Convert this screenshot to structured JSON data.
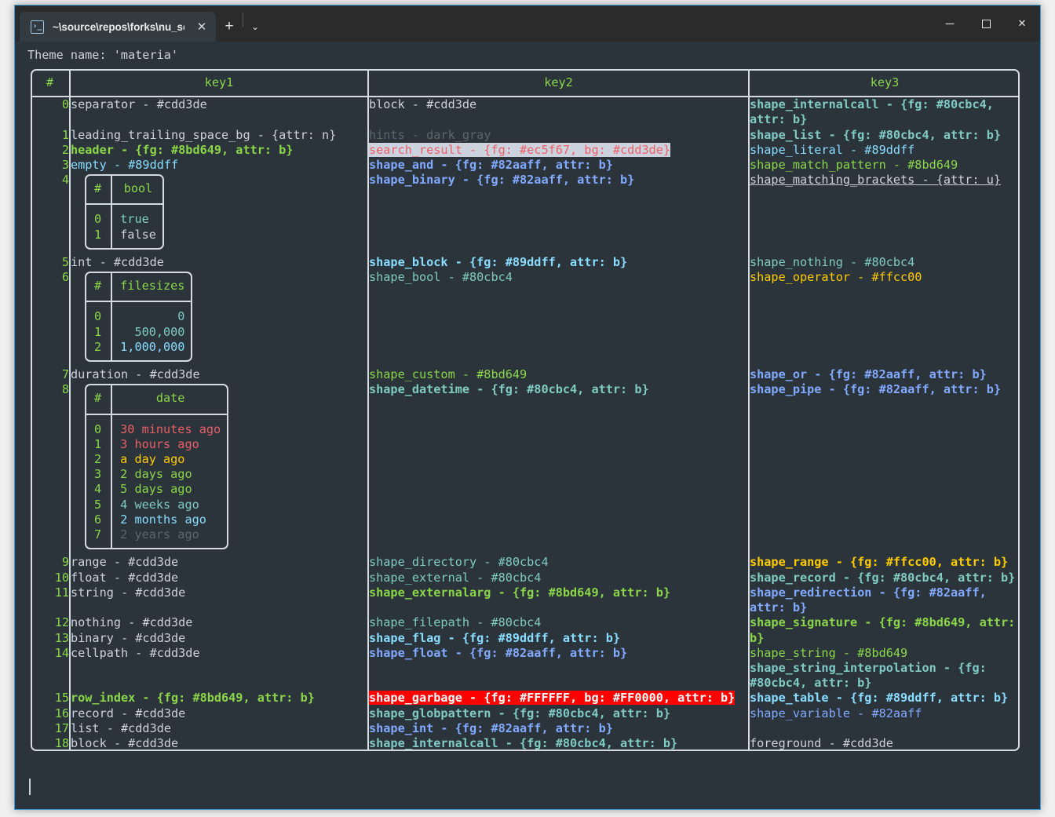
{
  "window": {
    "tab": {
      "icon": "powershell-prompt-icon",
      "title": "~\\source\\repos\\forks\\nu_scrip",
      "close_label": "✕"
    },
    "new_tab_label": "+",
    "dropdown_label": "⌄",
    "minimize_label": "─",
    "maximize_label": "",
    "close_label": "✕",
    "accent_color": "#3a9fe0",
    "titlebar_color": "#2b2b2b",
    "terminal_bg": "#2b333b"
  },
  "terminal": {
    "first_line": "Theme name: 'materia'",
    "prompt_cursor": "|"
  },
  "table": {
    "headers": [
      "#",
      "key1",
      "key2",
      "key3"
    ],
    "row_groups": [
      {
        "indices": [
          "0"
        ],
        "key1": [
          {
            "t": "separator - #cdd3de",
            "c": "fg"
          }
        ],
        "key2": [
          {
            "t": "block - #cdd3de",
            "c": "fg"
          }
        ],
        "key3": [
          {
            "t": "shape_internalcall - {fg: #80cbc4, attr: b}",
            "c": "cyan bold"
          }
        ]
      },
      {
        "indices": [
          "1",
          "2",
          "3",
          "4"
        ],
        "key1": [
          {
            "t": "leading_trailing_space_bg - {attr: n}",
            "c": "fg"
          },
          {
            "t": "header - {fg: #8bd649, attr: b}",
            "c": "green bold"
          },
          {
            "t": "empty - #89ddff",
            "c": "ltblue"
          }
        ],
        "key2": [
          {
            "t": "hints - dark_gray",
            "c": "gray"
          },
          {
            "t": "search_result - {fg: #ec5f67, bg: #cdd3de}",
            "c": "hl-search"
          },
          {
            "t": "shape_and - {fg: #82aaff, attr: b}",
            "c": "blue bold"
          },
          {
            "t": "shape_binary - {fg: #82aaff, attr: b}",
            "c": "blue bold"
          }
        ],
        "key3": [
          {
            "t": "shape_list - {fg: #80cbc4, attr: b}",
            "c": "cyan bold"
          },
          {
            "t": "shape_literal - #89ddff",
            "c": "ltblue"
          },
          {
            "t": "shape_match_pattern - #8bd649",
            "c": "green"
          },
          {
            "t": "shape_matching_brackets - {attr: u}",
            "c": "fg uline"
          }
        ]
      },
      {
        "indices": [
          "5",
          "6"
        ],
        "key1": [
          {
            "t": "int - #cdd3de",
            "c": "fg"
          }
        ],
        "key2": [
          {
            "t": "shape_block - {fg: #89ddff, attr: b}",
            "c": "ltblue bold"
          },
          {
            "t": "shape_bool - #80cbc4",
            "c": "cyan"
          }
        ],
        "key3": [
          {
            "t": "shape_nothing - #80cbc4",
            "c": "cyan"
          },
          {
            "t": "shape_operator - #ffcc00",
            "c": "yellow"
          }
        ]
      },
      {
        "indices": [
          "7",
          "8"
        ],
        "key1": [
          {
            "t": "duration - #cdd3de",
            "c": "fg"
          }
        ],
        "key2": [
          {
            "t": "shape_custom - #8bd649",
            "c": "green"
          },
          {
            "t": "shape_datetime - {fg: #80cbc4, attr: b}",
            "c": "cyan bold"
          }
        ],
        "key3": [
          {
            "t": "shape_or - {fg: #82aaff, attr: b}",
            "c": "blue bold"
          },
          {
            "t": "shape_pipe - {fg: #82aaff, attr: b}",
            "c": "blue bold"
          }
        ]
      },
      {
        "indices": [
          "9",
          "10",
          "11"
        ],
        "key1": [
          {
            "t": "range - #cdd3de",
            "c": "fg"
          },
          {
            "t": "float - #cdd3de",
            "c": "fg"
          },
          {
            "t": "string - #cdd3de",
            "c": "fg"
          }
        ],
        "key2": [
          {
            "t": "shape_directory - #80cbc4",
            "c": "cyan"
          },
          {
            "t": "shape_external - #80cbc4",
            "c": "cyan"
          },
          {
            "t": "shape_externalarg - {fg: #8bd649, attr: b}",
            "c": "green bold"
          }
        ],
        "key3": [
          {
            "t": "shape_range - {fg: #ffcc00, attr: b}",
            "c": "yellow bold"
          },
          {
            "t": "shape_record - {fg: #80cbc4, attr: b}",
            "c": "cyan bold"
          },
          {
            "t": "shape_redirection - {fg: #82aaff, attr: b}",
            "c": "blue bold"
          }
        ]
      },
      {
        "indices": [
          "12",
          "13",
          "14"
        ],
        "key1": [
          {
            "t": "nothing - #cdd3de",
            "c": "fg"
          },
          {
            "t": "binary - #cdd3de",
            "c": "fg"
          },
          {
            "t": "cellpath - #cdd3de",
            "c": "fg"
          }
        ],
        "key2": [
          {
            "t": "shape_filepath - #80cbc4",
            "c": "cyan"
          },
          {
            "t": "shape_flag - {fg: #89ddff, attr: b}",
            "c": "ltblue bold"
          },
          {
            "t": "shape_float - {fg: #82aaff, attr: b}",
            "c": "blue bold"
          }
        ],
        "key3": [
          {
            "t": "shape_signature - {fg: #8bd649, attr: b}",
            "c": "green bold"
          },
          {
            "t": "shape_string - #8bd649",
            "c": "green"
          },
          {
            "t": "shape_string_interpolation - {fg: #80cbc4, attr: b}",
            "c": "cyan bold"
          }
        ]
      },
      {
        "indices": [
          "15",
          "16",
          "17",
          "18"
        ],
        "key1": [
          {
            "t": "row_index - {fg: #8bd649, attr: b}",
            "c": "green bold"
          },
          {
            "t": "record - #cdd3de",
            "c": "fg"
          },
          {
            "t": "list - #cdd3de",
            "c": "fg"
          },
          {
            "t": "block - #cdd3de",
            "c": "fg"
          }
        ],
        "key2": [
          {
            "t": "shape_garbage - {fg: #FFFFFF, bg: #FF0000, attr: b}",
            "c": "hl-garbage"
          },
          {
            "t": "shape_globpattern - {fg: #80cbc4, attr: b}",
            "c": "cyan bold"
          },
          {
            "t": "shape_int - {fg: #82aaff, attr: b}",
            "c": "blue bold"
          },
          {
            "t": "shape_internalcall - {fg: #80cbc4, attr: b}",
            "c": "cyan bold"
          }
        ],
        "key3": [
          {
            "t": "shape_table - {fg: #89ddff, attr: b}",
            "c": "ltblue bold"
          },
          {
            "t": "shape_variable - #82aaff",
            "c": "blue"
          },
          {
            "t": "",
            "c": "fg"
          },
          {
            "t": "foreground - #cdd3de",
            "c": "fg"
          }
        ]
      }
    ]
  },
  "nested_tables": {
    "bool": {
      "headers": [
        "#",
        "bool"
      ],
      "rows": [
        {
          "idx": "0",
          "value": "true",
          "color": "cyan"
        },
        {
          "idx": "1",
          "value": "false",
          "color": "fg"
        }
      ]
    },
    "filesizes": {
      "headers": [
        "#",
        "filesizes"
      ],
      "rows": [
        {
          "idx": "0",
          "value": "0",
          "color": "cyan"
        },
        {
          "idx": "1",
          "value": "500,000",
          "color": "cyan"
        },
        {
          "idx": "2",
          "value": "1,000,000",
          "color": "ltblue"
        }
      ]
    },
    "date": {
      "headers": [
        "#",
        "date"
      ],
      "rows": [
        {
          "idx": "0",
          "value": "30 minutes ago",
          "color": "red"
        },
        {
          "idx": "1",
          "value": "3 hours ago",
          "color": "red"
        },
        {
          "idx": "2",
          "value": "a day ago",
          "color": "yellow"
        },
        {
          "idx": "3",
          "value": "2 days ago",
          "color": "green"
        },
        {
          "idx": "4",
          "value": "5 days ago",
          "color": "green"
        },
        {
          "idx": "5",
          "value": "4 weeks ago",
          "color": "cyan"
        },
        {
          "idx": "6",
          "value": "2 months ago",
          "color": "ltblue"
        },
        {
          "idx": "7",
          "value": "2 years ago",
          "color": "gray"
        }
      ]
    }
  }
}
